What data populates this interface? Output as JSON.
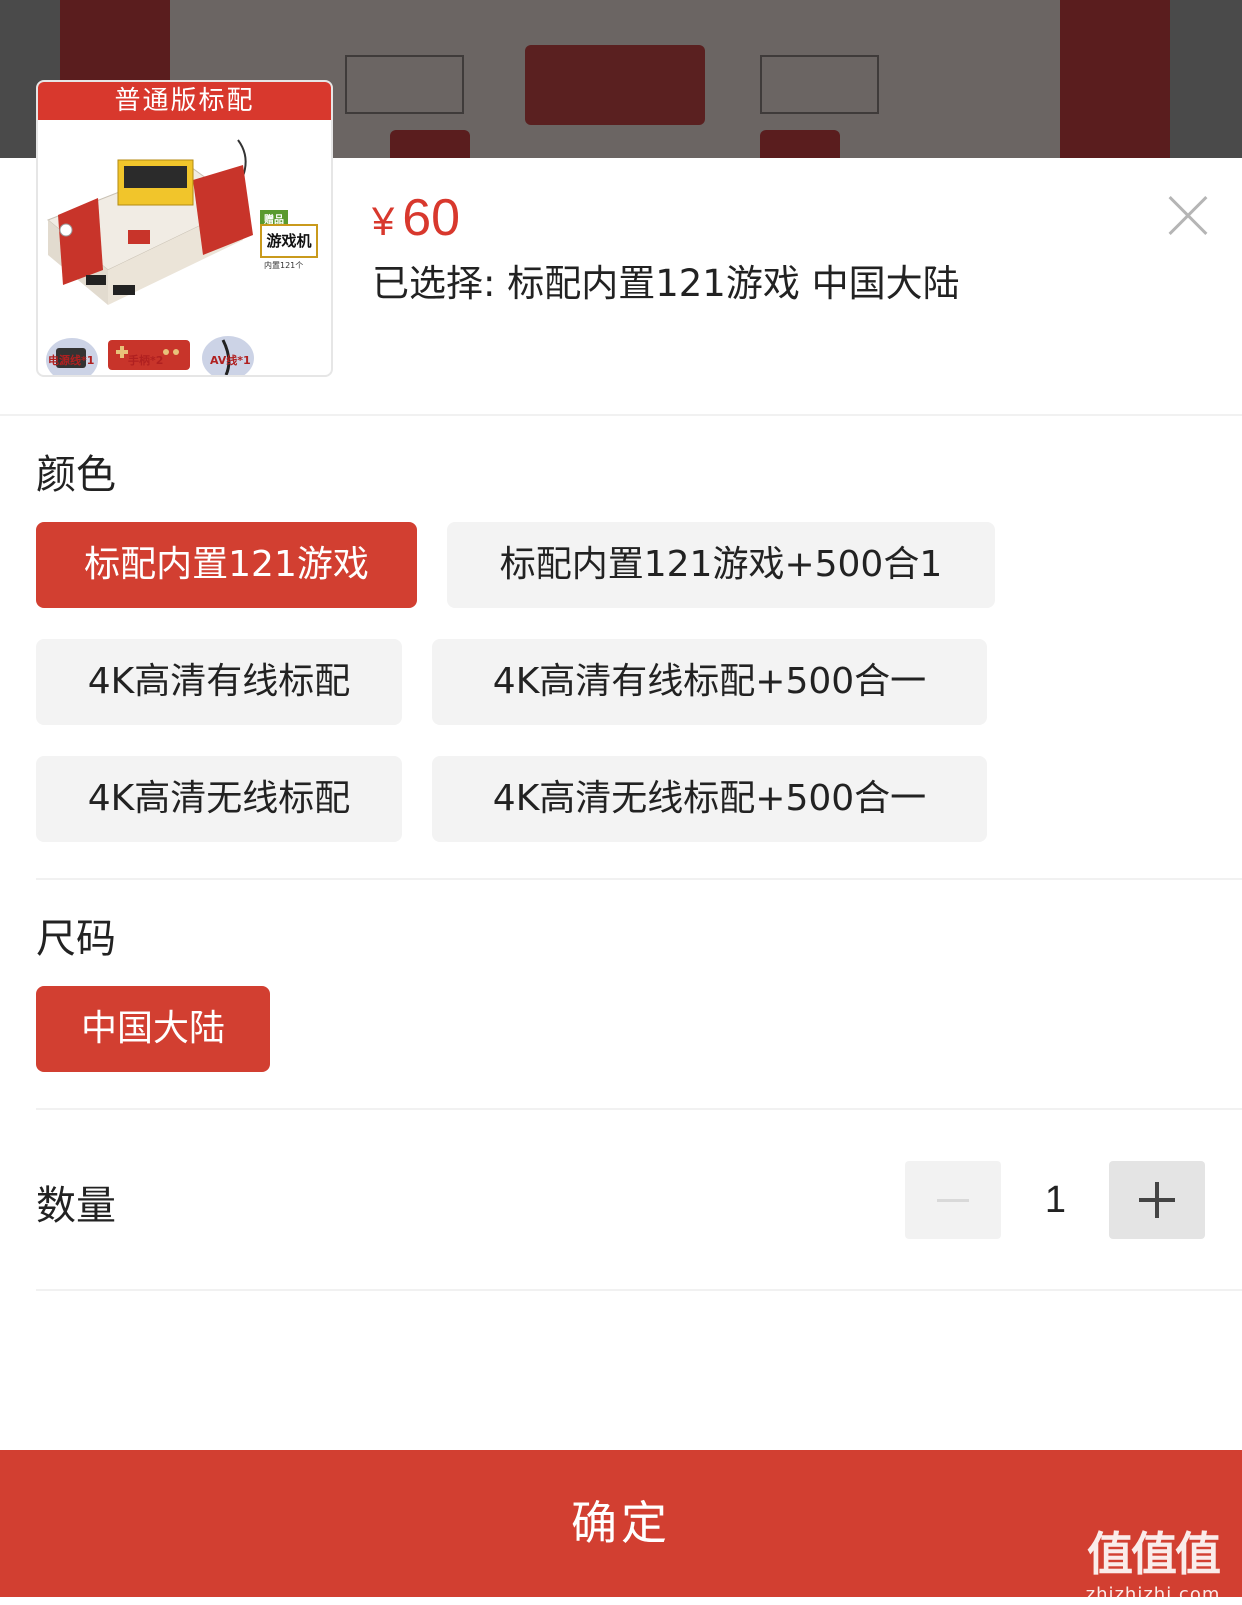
{
  "product": {
    "thumb_banner": "普通版标配",
    "gift_tag": "赠品",
    "gift_label": "游戏机",
    "gift_sub": "内置121个",
    "accessories": [
      "电源线*1",
      "手柄*2",
      "AV线*1"
    ],
    "currency": "¥",
    "price": "60",
    "selected_text": "已选择: 标配内置121游戏 中国大陆"
  },
  "color_section": {
    "title": "颜色",
    "options": [
      {
        "label": "标配内置121游戏",
        "selected": true
      },
      {
        "label": "标配内置121游戏+500合1",
        "selected": false
      },
      {
        "label": "4K高清有线标配",
        "selected": false
      },
      {
        "label": "4K高清有线标配+500合一",
        "selected": false
      },
      {
        "label": "4K高清无线标配",
        "selected": false
      },
      {
        "label": "4K高清无线标配+500合一",
        "selected": false
      }
    ]
  },
  "size_section": {
    "title": "尺码",
    "options": [
      {
        "label": "中国大陆",
        "selected": true
      }
    ]
  },
  "quantity": {
    "label": "数量",
    "value": "1"
  },
  "confirm_button": "确定",
  "watermark": {
    "big": "值值值",
    "small": "zhizhizhi.com"
  },
  "colors": {
    "accent": "#d23f31",
    "chip_bg": "#f3f3f3"
  }
}
